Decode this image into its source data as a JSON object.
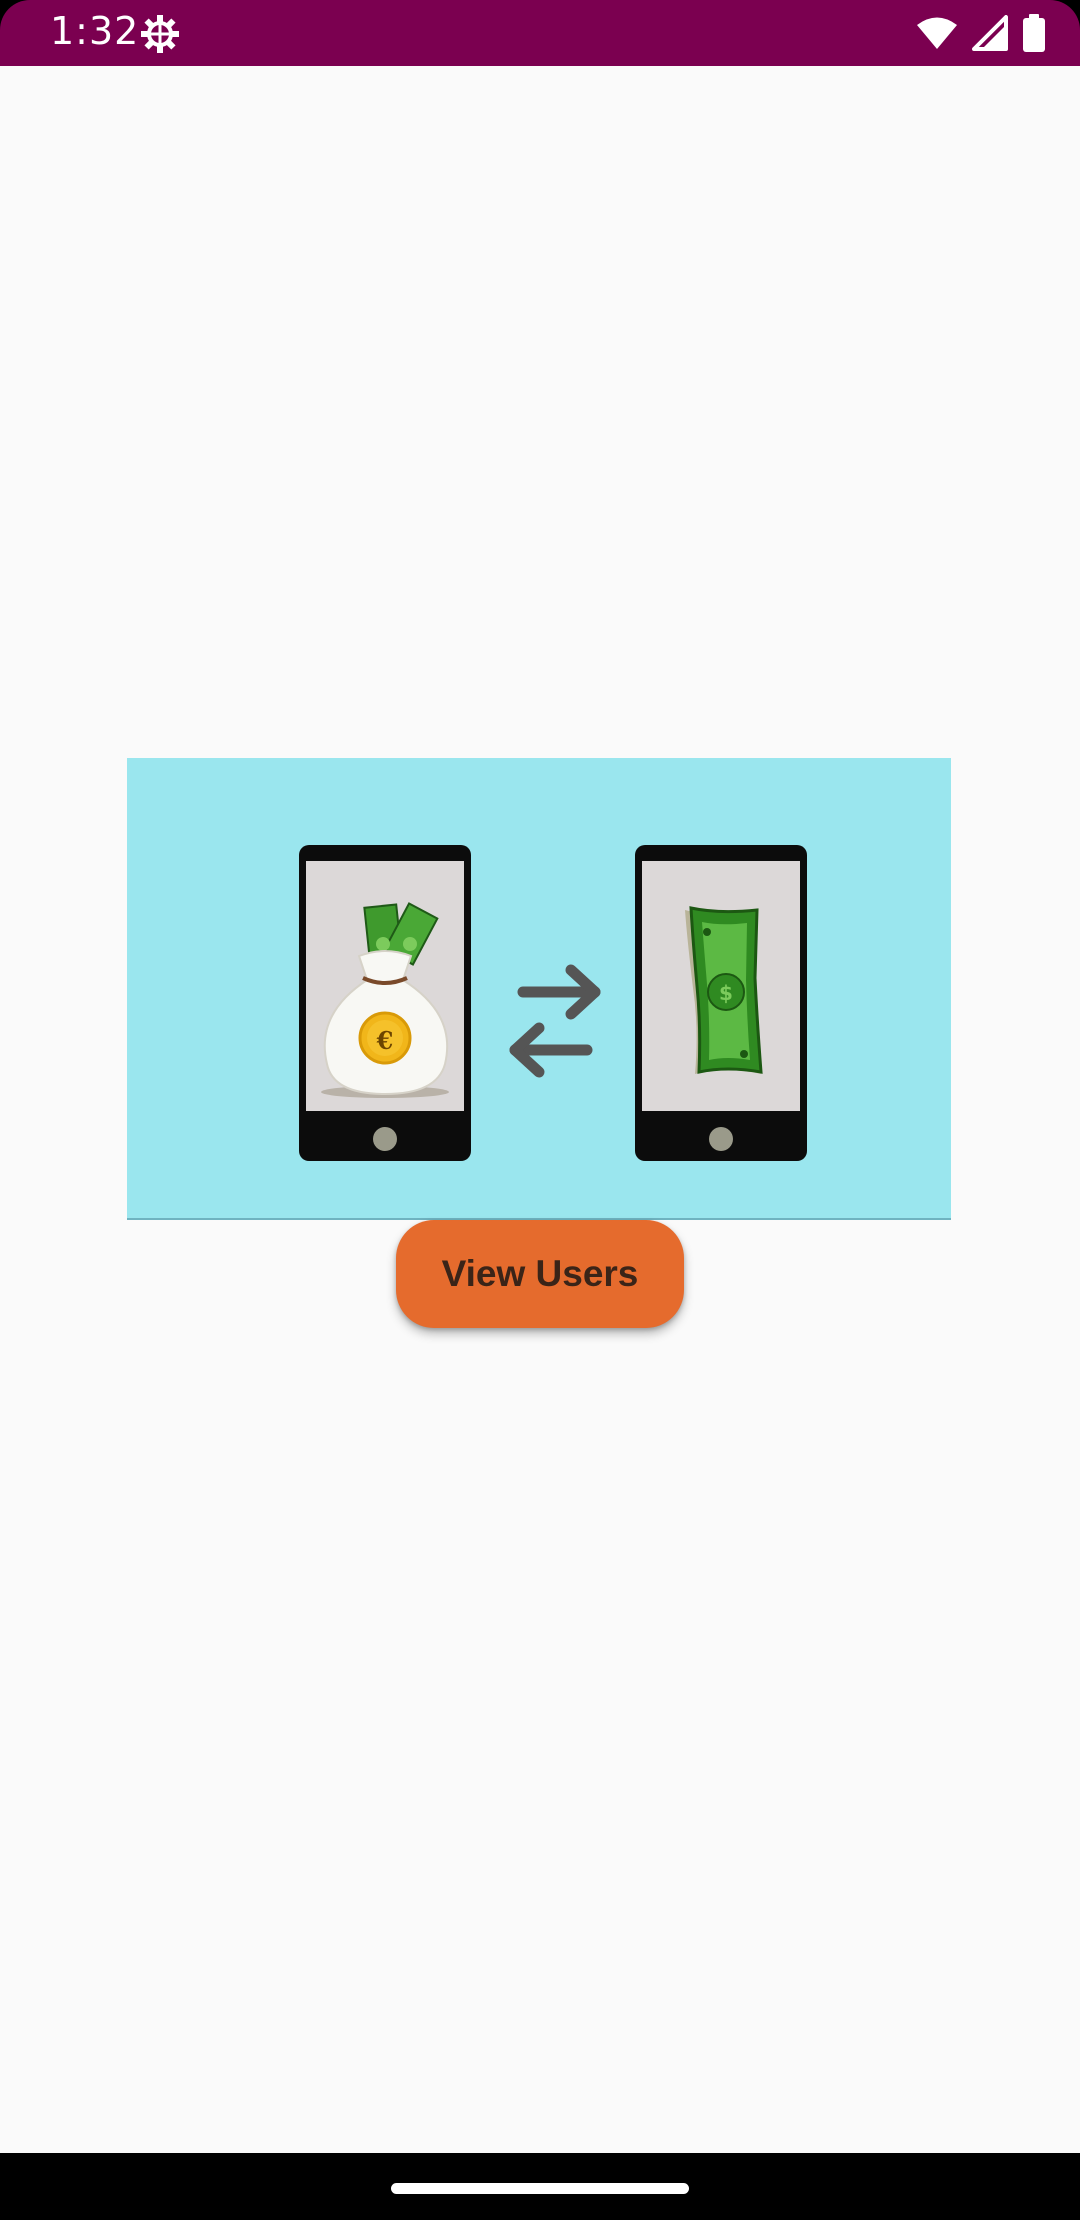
{
  "status_bar": {
    "time": "1:32",
    "icons": [
      "settings-gear-icon",
      "wifi-icon",
      "cellular-signal-icon",
      "battery-icon"
    ],
    "background": "#7b0050"
  },
  "main": {
    "background": "#fafafa",
    "hero_image": {
      "description_icons": [
        "phone-icon",
        "money-bag-icon",
        "euro-coin-icon",
        "transfer-arrows-icon",
        "dollar-bill-icon"
      ],
      "background": "#9ae6ee"
    },
    "view_users_button": {
      "label": "View Users",
      "color": "#e56b2d"
    }
  },
  "nav_bar": {
    "background": "#000000",
    "handle": "home-gesture-handle"
  }
}
